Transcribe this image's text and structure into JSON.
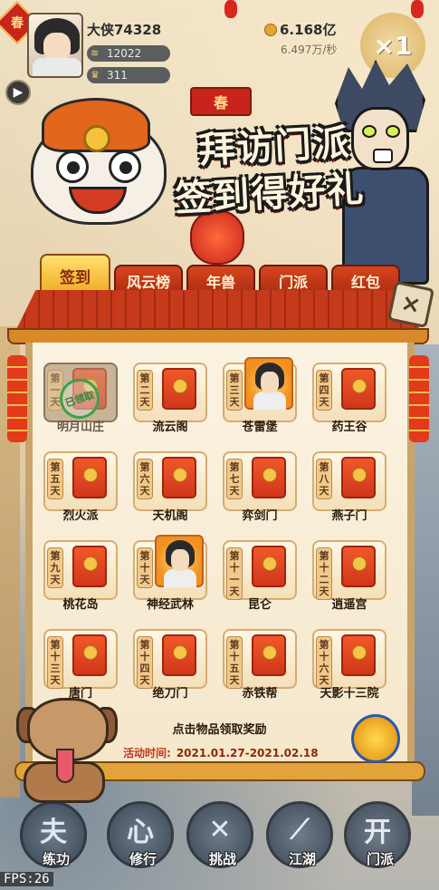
{
  "hud": {
    "season_badge": "春",
    "player_name": "大侠74328",
    "stat_1": "12022",
    "stat_2": "311",
    "gold": "6.168亿",
    "gold_rate": "6.497万/秒",
    "speed_label": "×1"
  },
  "event": {
    "banner": "春",
    "title_line1": "拜访门派",
    "title_line2": "签到得好礼",
    "hint": "点击物品领取奖励",
    "time_label": "活动时间:",
    "time_value": "2021.01.27-2021.02.18"
  },
  "tabs": [
    {
      "label": "签到",
      "active": true
    },
    {
      "label": "风云榜",
      "active": false
    },
    {
      "label": "年兽",
      "active": false
    },
    {
      "label": "门派",
      "active": false
    },
    {
      "label": "红包",
      "active": false
    }
  ],
  "close_icon": "×",
  "stamp_text": "已领取",
  "days": [
    {
      "day": "第一天",
      "name": "明月山庄",
      "claimed": true,
      "reward": "red-envelope"
    },
    {
      "day": "第二天",
      "name": "流云阁",
      "claimed": false,
      "reward": "red-envelope"
    },
    {
      "day": "第三天",
      "name": "苍雷堡",
      "claimed": false,
      "reward": "character"
    },
    {
      "day": "第四天",
      "name": "药王谷",
      "claimed": false,
      "reward": "red-envelope"
    },
    {
      "day": "第五天",
      "name": "烈火派",
      "claimed": false,
      "reward": "red-envelope"
    },
    {
      "day": "第六天",
      "name": "天机阁",
      "claimed": false,
      "reward": "red-envelope"
    },
    {
      "day": "第七天",
      "name": "弈剑门",
      "claimed": false,
      "reward": "red-envelope"
    },
    {
      "day": "第八天",
      "name": "燕子门",
      "claimed": false,
      "reward": "red-envelope"
    },
    {
      "day": "第九天",
      "name": "桃花岛",
      "claimed": false,
      "reward": "red-envelope"
    },
    {
      "day": "第十天",
      "name": "神经武林",
      "claimed": false,
      "reward": "character"
    },
    {
      "day": "第十一天",
      "name": "昆仑",
      "claimed": false,
      "reward": "red-envelope"
    },
    {
      "day": "第十二天",
      "name": "逍遥宫",
      "claimed": false,
      "reward": "red-envelope"
    },
    {
      "day": "第十三天",
      "name": "唐门",
      "claimed": false,
      "reward": "red-envelope"
    },
    {
      "day": "第十四天",
      "name": "绝刀门",
      "claimed": false,
      "reward": "red-envelope"
    },
    {
      "day": "第十五天",
      "name": "赤铁帮",
      "claimed": false,
      "reward": "red-envelope"
    },
    {
      "day": "第十六天",
      "name": "天影十三院",
      "claimed": false,
      "reward": "red-envelope"
    }
  ],
  "bottom_nav": [
    {
      "label": "练功",
      "icon": "train-icon",
      "glyph": "夫"
    },
    {
      "label": "修行",
      "icon": "heart-icon",
      "glyph": "心"
    },
    {
      "label": "挑战",
      "icon": "swords-icon",
      "glyph": "✕"
    },
    {
      "label": "江湖",
      "icon": "blade-icon",
      "glyph": "⟋"
    },
    {
      "label": "门派",
      "icon": "gate-icon",
      "glyph": "开"
    }
  ],
  "fps": "FPS:26",
  "colors": {
    "tab_active": "#f0a820",
    "tab_inactive": "#c43a1a",
    "red_envelope": "#e0461e",
    "stamp_green": "#2a8a3a",
    "event_time": "#c0361a"
  }
}
